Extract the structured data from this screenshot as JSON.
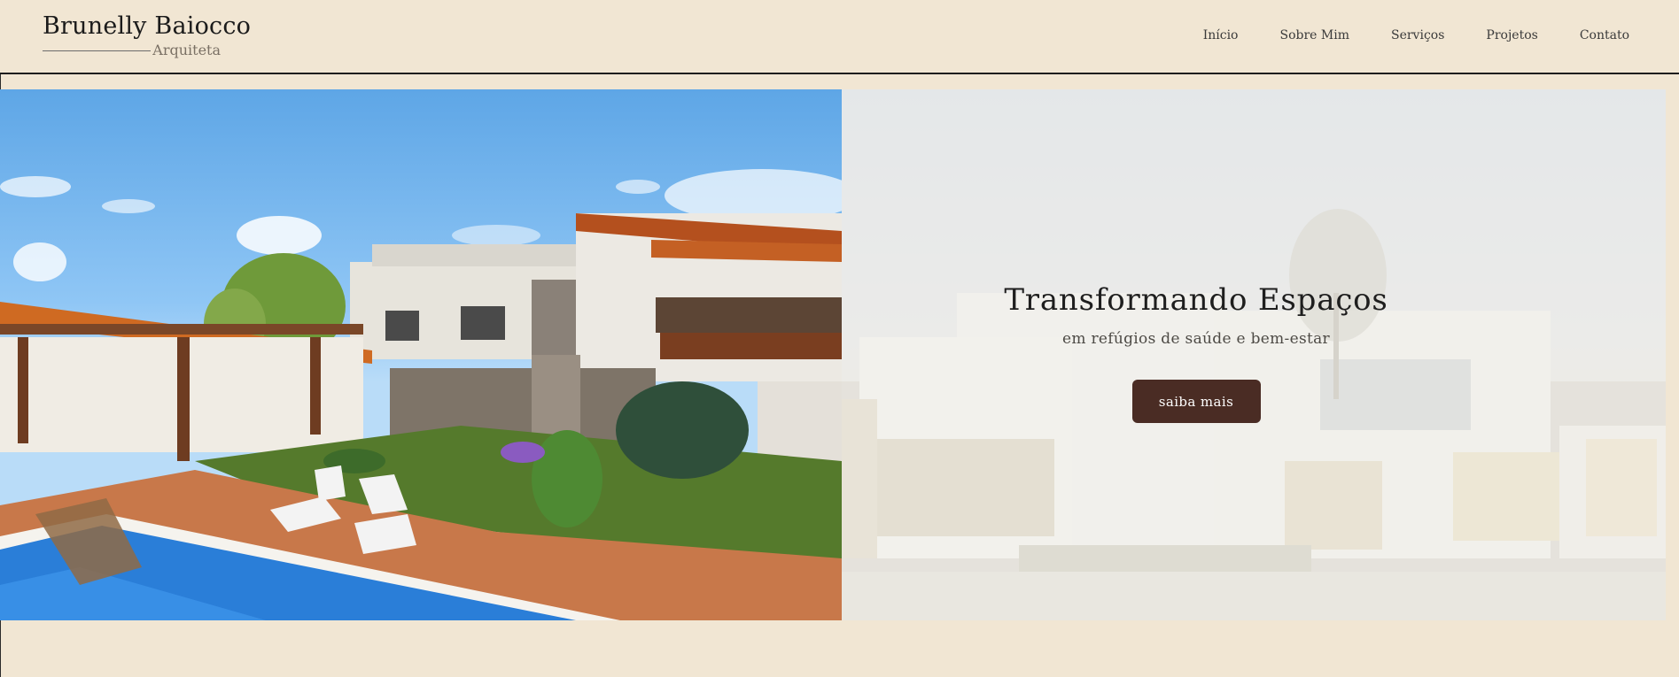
{
  "brand": {
    "name": "Brunelly Baiocco",
    "subtitle": "Arquiteta"
  },
  "nav": {
    "items": [
      "Início",
      "Sobre Mim",
      "Serviços",
      "Projetos",
      "Contato"
    ]
  },
  "hero": {
    "title": "Transformando Espaços",
    "subtitle": "em refúgios de saúde e bem-estar",
    "button_label": "saiba mais"
  },
  "colors": {
    "page_background": "#f1e6d3",
    "button_background": "#4a2c24",
    "button_text": "#ffffff",
    "header_border": "#1d1d1d"
  }
}
